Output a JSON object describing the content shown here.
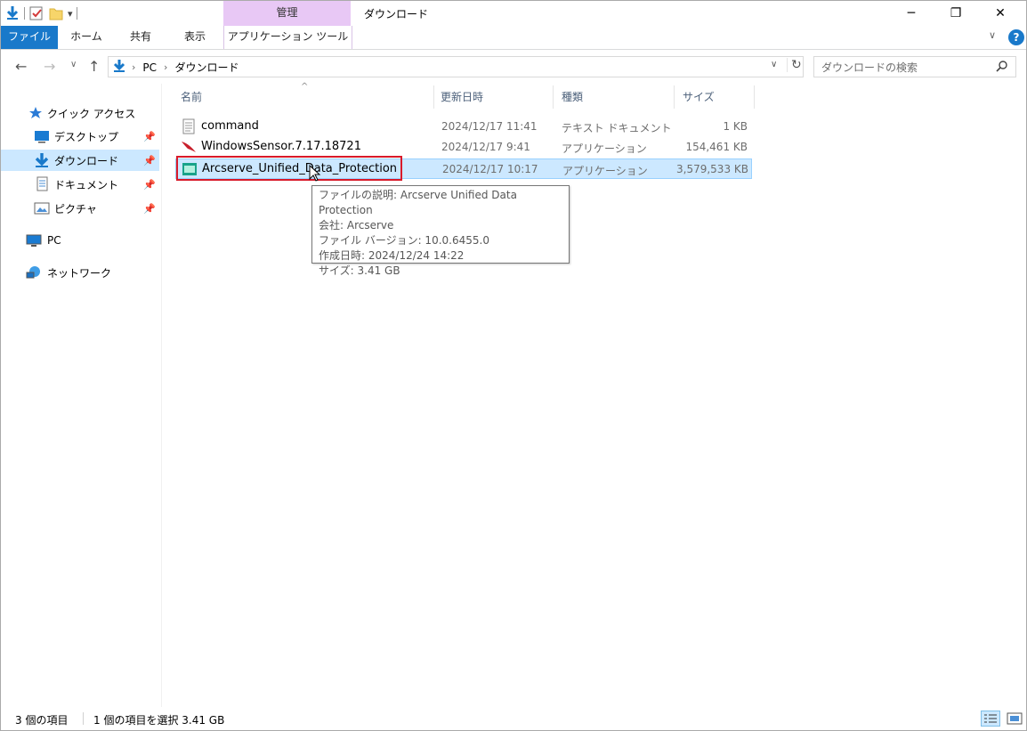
{
  "titlebar": {
    "context_header": "管理",
    "title": "ダウンロード",
    "minimize_glyph": "─",
    "maximize_glyph": "❐",
    "close_glyph": "✕",
    "qat_dropdown_glyph": "▾"
  },
  "ribbon": {
    "tabs": [
      "ファイル",
      "ホーム",
      "共有",
      "表示",
      "アプリケーション ツール"
    ],
    "expand_glyph": "∨",
    "help_glyph": "?",
    "accent_color": "#1979ca"
  },
  "address": {
    "back_glyph": "←",
    "forward_glyph": "→",
    "recent_glyph": "∨",
    "up_glyph": "↑",
    "breadcrumbs": [
      "PC",
      "ダウンロード"
    ],
    "crumb_separator": "›",
    "dropdown_glyph": "∨",
    "refresh_glyph": "↻"
  },
  "search": {
    "placeholder": "ダウンロードの検索"
  },
  "navpane": {
    "pin_glyph": "📌",
    "items": [
      {
        "label": "クイック アクセス",
        "icon": "star-icon"
      },
      {
        "label": "デスクトップ",
        "icon": "desktop-icon"
      },
      {
        "label": "ダウンロード",
        "icon": "download-icon"
      },
      {
        "label": "ドキュメント",
        "icon": "document-icon"
      },
      {
        "label": "ピクチャ",
        "icon": "pictures-icon"
      },
      {
        "label": "PC",
        "icon": "pc-icon"
      },
      {
        "label": "ネットワーク",
        "icon": "network-icon"
      }
    ]
  },
  "filelist": {
    "sort_glyph": "^",
    "columns": {
      "name": "名前",
      "date": "更新日時",
      "type": "種類",
      "size": "サイズ"
    },
    "rows": [
      {
        "name": "command",
        "date": "2024/12/17 11:41",
        "type": "テキスト ドキュメント",
        "size": "1 KB",
        "icon": "text-file-icon"
      },
      {
        "name": "WindowsSensor.7.17.18721",
        "date": "2024/12/17 9:41",
        "type": "アプリケーション",
        "size": "154,461 KB",
        "icon": "falcon-app-icon"
      },
      {
        "name": "Arcserve_Unified_Data_Protection",
        "date": "2024/12/17 10:17",
        "type": "アプリケーション",
        "size": "3,579,533 KB",
        "icon": "arcserve-app-icon"
      }
    ]
  },
  "tooltip": {
    "lines": [
      "ファイルの説明: Arcserve Unified Data Protection",
      "会社: Arcserve",
      "ファイル バージョン: 10.0.6455.0",
      "作成日時: 2024/12/24 14:22",
      "サイズ: 3.41 GB"
    ]
  },
  "status": {
    "count": "3 個の項目",
    "selected": "1 個の項目を選択  3.41 GB"
  }
}
